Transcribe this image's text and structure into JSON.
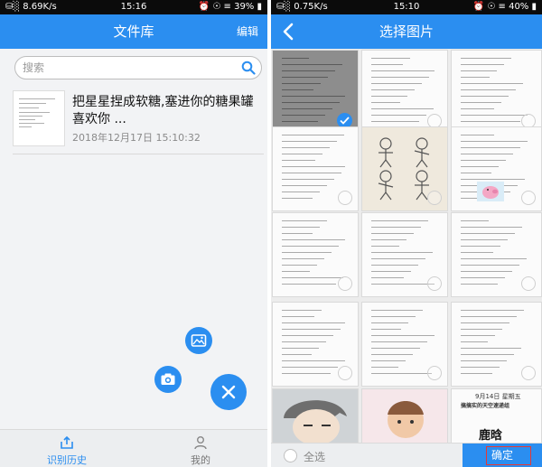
{
  "left": {
    "status": {
      "signal": "⛁░",
      "speed": "8.69K/s",
      "time": "15:16",
      "icons": "⏰ ☉ ≡",
      "battery": "39%"
    },
    "app_bar": {
      "title": "文件库",
      "edit": "编辑"
    },
    "search": {
      "placeholder": "搜索",
      "icon": "search-icon"
    },
    "files": [
      {
        "name": "把星星捏成软糖,塞进你的糖果罐喜欢你 ...",
        "date": "2018年12月17日 15:10:32"
      }
    ],
    "fabs": {
      "gallery": "image-icon",
      "camera": "camera-icon",
      "close": "close-icon"
    },
    "nav": {
      "history": "识别历史",
      "mine": "我的"
    }
  },
  "right": {
    "status": {
      "signal": "⛁░",
      "speed": "0.75K/s",
      "time": "15:10",
      "icons": "⏰ ☉ ≡",
      "battery": "40%"
    },
    "app_bar": {
      "title": "选择图片",
      "back_icon": "back-chevron-icon"
    },
    "thumbs": {
      "poster_title": "鹿晗",
      "poster_date": "9月14日 星期五",
      "poster_line": "搞搞实的天空速递组"
    },
    "select_all": "全选",
    "confirm": "确定"
  },
  "colors": {
    "accent": "#2b8ef0",
    "highlight_box": "#e53935",
    "status_bar": "#0b0b0b"
  }
}
